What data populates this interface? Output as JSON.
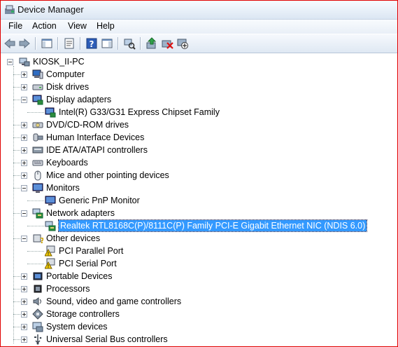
{
  "window": {
    "title": "Device Manager"
  },
  "menu": [
    "File",
    "Action",
    "View",
    "Help"
  ],
  "toolbar": [
    {
      "icon": "back-arrow-icon"
    },
    {
      "icon": "forward-arrow-icon"
    },
    {
      "icon": "show-hide-console-tree-icon"
    },
    {
      "icon": "properties-icon"
    },
    {
      "icon": "help-icon"
    },
    {
      "icon": "show-hide-action-pane-icon"
    },
    {
      "icon": "scan-hardware-changes-icon"
    },
    {
      "icon": "update-driver-icon"
    },
    {
      "icon": "uninstall-icon"
    },
    {
      "icon": "disable-device-icon"
    }
  ],
  "tree": {
    "root": {
      "label": "KIOSK_II-PC",
      "icon": "computer-network-icon"
    },
    "nodes": [
      {
        "label": "Computer",
        "icon": "computer-icon",
        "state": "collapsed",
        "children": []
      },
      {
        "label": "Disk drives",
        "icon": "disk-drive-icon",
        "state": "collapsed",
        "children": []
      },
      {
        "label": "Display adapters",
        "icon": "display-adapter-icon",
        "state": "expanded",
        "children": [
          {
            "label": "Intel(R) G33/G31 Express Chipset Family",
            "icon": "display-adapter-icon"
          }
        ]
      },
      {
        "label": "DVD/CD-ROM drives",
        "icon": "dvd-drive-icon",
        "state": "collapsed",
        "children": []
      },
      {
        "label": "Human Interface Devices",
        "icon": "hid-icon",
        "state": "collapsed",
        "children": []
      },
      {
        "label": "IDE ATA/ATAPI controllers",
        "icon": "ide-controller-icon",
        "state": "collapsed",
        "children": []
      },
      {
        "label": "Keyboards",
        "icon": "keyboard-icon",
        "state": "collapsed",
        "children": []
      },
      {
        "label": "Mice and other pointing devices",
        "icon": "mouse-icon",
        "state": "collapsed",
        "children": []
      },
      {
        "label": "Monitors",
        "icon": "monitor-icon",
        "state": "expanded",
        "children": [
          {
            "label": "Generic PnP Monitor",
            "icon": "monitor-icon"
          }
        ]
      },
      {
        "label": "Network adapters",
        "icon": "network-adapter-icon",
        "state": "expanded",
        "children": [
          {
            "label": "Realtek RTL8168C(P)/8111C(P) Family PCI-E Gigabit Ethernet NIC (NDIS 6.0)",
            "icon": "network-adapter-icon",
            "selected": true
          }
        ]
      },
      {
        "label": "Other devices",
        "icon": "unknown-device-icon",
        "state": "expanded",
        "children": [
          {
            "label": "PCI Parallel Port",
            "icon": "warning-device-icon"
          },
          {
            "label": "PCI Serial Port",
            "icon": "warning-device-icon"
          }
        ]
      },
      {
        "label": "Portable Devices",
        "icon": "portable-device-icon",
        "state": "collapsed",
        "children": []
      },
      {
        "label": "Processors",
        "icon": "processor-icon",
        "state": "collapsed",
        "children": []
      },
      {
        "label": "Sound, video and game controllers",
        "icon": "sound-icon",
        "state": "collapsed",
        "children": []
      },
      {
        "label": "Storage controllers",
        "icon": "storage-controller-icon",
        "state": "collapsed",
        "children": []
      },
      {
        "label": "System devices",
        "icon": "system-devices-icon",
        "state": "collapsed",
        "children": []
      },
      {
        "label": "Universal Serial Bus controllers",
        "icon": "usb-icon",
        "state": "collapsed",
        "children": []
      }
    ]
  },
  "colors": {
    "selection": "#3399ff",
    "border": "#e00000"
  }
}
